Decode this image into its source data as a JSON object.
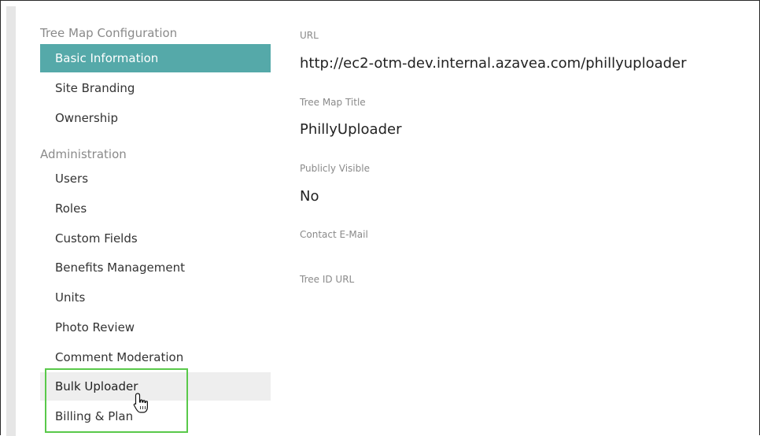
{
  "sidebar": {
    "config_title": "Tree Map Configuration",
    "config_items": [
      {
        "label": "Basic Information"
      },
      {
        "label": "Site Branding"
      },
      {
        "label": "Ownership"
      }
    ],
    "admin_title": "Administration",
    "admin_items": [
      {
        "label": "Users"
      },
      {
        "label": "Roles"
      },
      {
        "label": "Custom Fields"
      },
      {
        "label": "Benefits Management"
      },
      {
        "label": "Units"
      },
      {
        "label": "Photo Review"
      },
      {
        "label": "Comment Moderation"
      },
      {
        "label": "Bulk Uploader"
      },
      {
        "label": "Billing & Plan"
      }
    ],
    "active_item": "Basic Information",
    "hovered_item": "Bulk Uploader"
  },
  "details": {
    "url_label": "URL",
    "url_value": "http://ec2-otm-dev.internal.azavea.com/phillyuploader",
    "title_label": "Tree Map Title",
    "title_value": "PhillyUploader",
    "visible_label": "Publicly Visible",
    "visible_value": "No",
    "email_label": "Contact E-Mail",
    "email_value": "",
    "treeid_label": "Tree ID URL",
    "treeid_value": ""
  },
  "colors": {
    "active_bg": "#55a9a9",
    "highlight_border": "#59c94a"
  }
}
